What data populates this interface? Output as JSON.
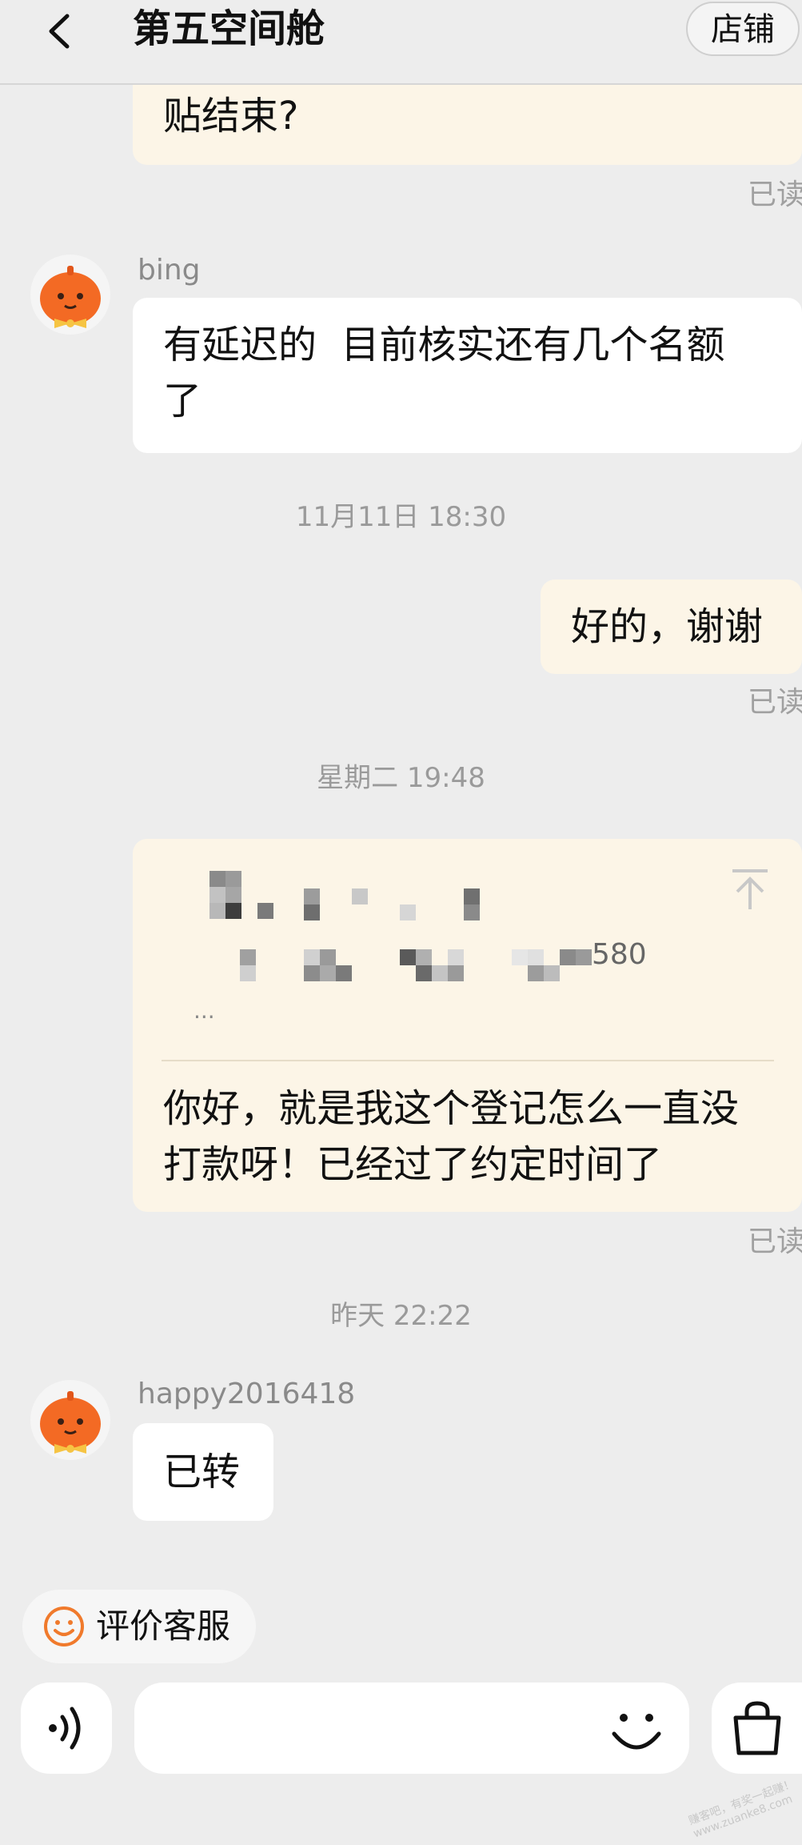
{
  "header": {
    "title": "第五空间舱",
    "shop_label": "店铺"
  },
  "messages": {
    "m1": {
      "text": "贴结束?",
      "read": "已读"
    },
    "m2": {
      "sender": "bing",
      "line1": "有延迟的  目前核实还有几个名额",
      "line2": "了"
    },
    "t1": "11月11日 18:30",
    "m3": {
      "text": "好的，谢谢",
      "read": "已读"
    },
    "t2": "星期二 19:48",
    "m4": {
      "quote_suffix": "580",
      "quote_more": "...",
      "line1": "你好，就是我这个登记怎么一直没",
      "line2": "打款呀！已经过了约定时间了",
      "read": "已读"
    },
    "t3": "昨天 22:22",
    "m5": {
      "sender": "happy2016418",
      "text": "已转"
    }
  },
  "footer": {
    "eval_label": "评价客服"
  },
  "watermark": "赚客吧，有奖一起赚！ www.zuanke8.com"
}
